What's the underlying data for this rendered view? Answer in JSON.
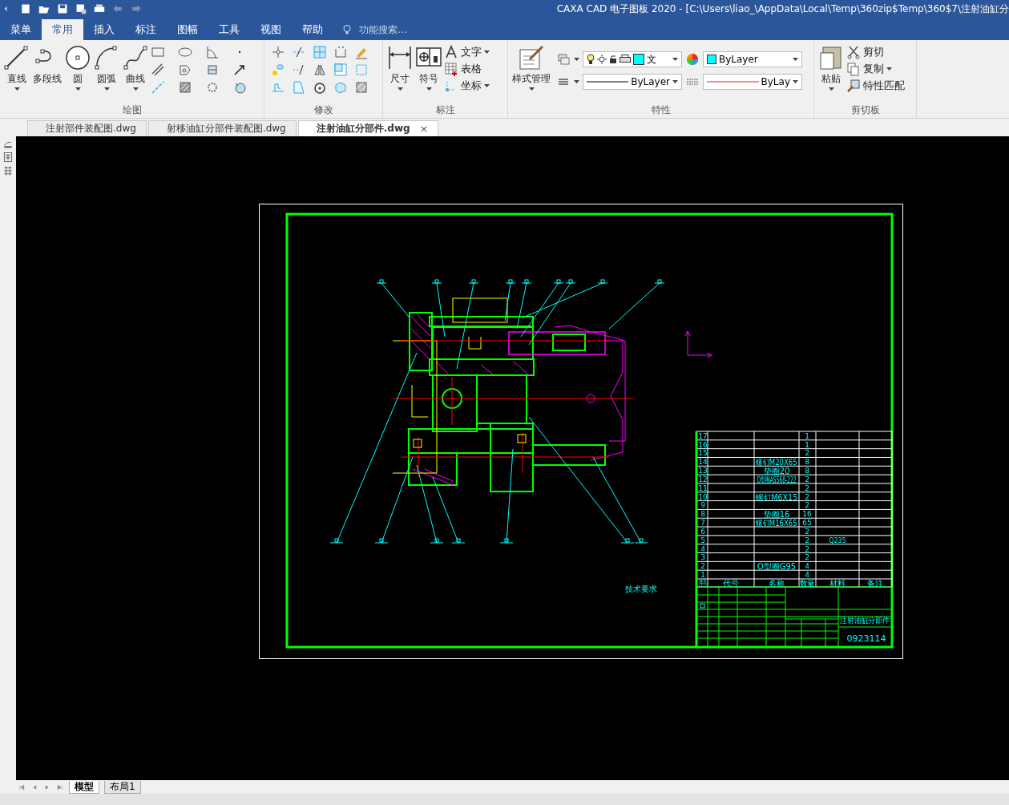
{
  "title_bar": {
    "title": "CAXA CAD 电子图板 2020 - [C:\\Users\\liao_\\AppData\\Local\\Temp\\360zip$Temp\\360$7\\注射油缸分"
  },
  "menu_tabs": [
    {
      "label": "菜单",
      "selected": false
    },
    {
      "label": "常用",
      "selected": true
    },
    {
      "label": "插入",
      "selected": false
    },
    {
      "label": "标注",
      "selected": false
    },
    {
      "label": "图幅",
      "selected": false
    },
    {
      "label": "工具",
      "selected": false
    },
    {
      "label": "视图",
      "selected": false
    },
    {
      "label": "帮助",
      "selected": false
    }
  ],
  "search": {
    "placeholder": "功能搜索..."
  },
  "ribbon": {
    "draw_group": {
      "title": "绘图",
      "tools": [
        {
          "label": "直线",
          "dropdown": true
        },
        {
          "label": "多段线",
          "dropdown": false
        },
        {
          "label": "圆",
          "dropdown": true
        },
        {
          "label": "圆弧",
          "dropdown": true
        },
        {
          "label": "曲线",
          "dropdown": true
        }
      ]
    },
    "modify_group": {
      "title": "修改"
    },
    "annotate_group": {
      "title": "标注",
      "tools": [
        {
          "label": "尺寸",
          "dropdown": true
        },
        {
          "label": "符号",
          "dropdown": true
        }
      ],
      "small_tools": [
        {
          "label": "文字",
          "dropdown": true
        },
        {
          "label": "表格",
          "dropdown": false
        },
        {
          "label": "坐标",
          "dropdown": true
        }
      ]
    },
    "properties_group": {
      "title": "特性",
      "style_manager": {
        "label": "样式管理"
      },
      "layer_combo": "文",
      "color_combo": "ByLayer",
      "linetype_combo": "ByLayer",
      "lineweight_combo": "ByLay"
    },
    "clipboard_group": {
      "title": "剪切板",
      "paste": {
        "label": "粘贴"
      },
      "small_tools": [
        {
          "label": "剪切",
          "dropdown": false
        },
        {
          "label": "复制",
          "dropdown": true
        },
        {
          "label": "特性匹配",
          "dropdown": false
        }
      ]
    }
  },
  "doc_tabs": [
    {
      "label": "注射部件装配图.dwg",
      "selected": false
    },
    {
      "label": "射移油缸分部件装配图.dwg",
      "selected": false
    },
    {
      "label": "注射油缸分部件.dwg",
      "selected": true,
      "close": "×"
    }
  ],
  "drawing": {
    "parts_list": {
      "header": [
        "序号",
        "代号",
        "名称",
        "数量",
        "材料",
        "备注"
      ],
      "rows": [
        {
          "no": "17",
          "name": "",
          "qty": "1",
          "material": ""
        },
        {
          "no": "16",
          "name": "",
          "qty": "1",
          "material": ""
        },
        {
          "no": "15",
          "name": "",
          "qty": "2",
          "material": ""
        },
        {
          "no": "14",
          "name": "螺钉M20X65",
          "qty": "8",
          "material": ""
        },
        {
          "no": "13",
          "name": "垫圈20",
          "qty": "8",
          "material": ""
        },
        {
          "no": "12",
          "name": "O型圈AS568-222",
          "qty": "2",
          "material": ""
        },
        {
          "no": "11",
          "name": "",
          "qty": "2",
          "material": ""
        },
        {
          "no": "10",
          "name": "螺钉M6X15",
          "qty": "2",
          "material": ""
        },
        {
          "no": "9",
          "name": "",
          "qty": "2",
          "material": ""
        },
        {
          "no": "8",
          "name": "垫圈16",
          "qty": "16",
          "material": ""
        },
        {
          "no": "7",
          "name": "螺钉M16X65",
          "qty": "65",
          "material": ""
        },
        {
          "no": "6",
          "name": "",
          "qty": "2",
          "material": ""
        },
        {
          "no": "5",
          "name": "",
          "qty": "2",
          "material": "Q235"
        },
        {
          "no": "4",
          "name": "",
          "qty": "2",
          "material": ""
        },
        {
          "no": "3",
          "name": "",
          "qty": "2",
          "material": ""
        },
        {
          "no": "2",
          "name": "O型圈G95",
          "qty": "4",
          "material": ""
        },
        {
          "no": "1",
          "name": "",
          "qty": "4",
          "material": ""
        }
      ]
    },
    "notes_title": "技术要求",
    "title_block": {
      "drawing_name": "注射油缸分部件",
      "drawing_number": "0923114"
    }
  },
  "layout_tabs": [
    {
      "label": "模型",
      "selected": true
    },
    {
      "label": "布局1",
      "selected": false
    }
  ]
}
